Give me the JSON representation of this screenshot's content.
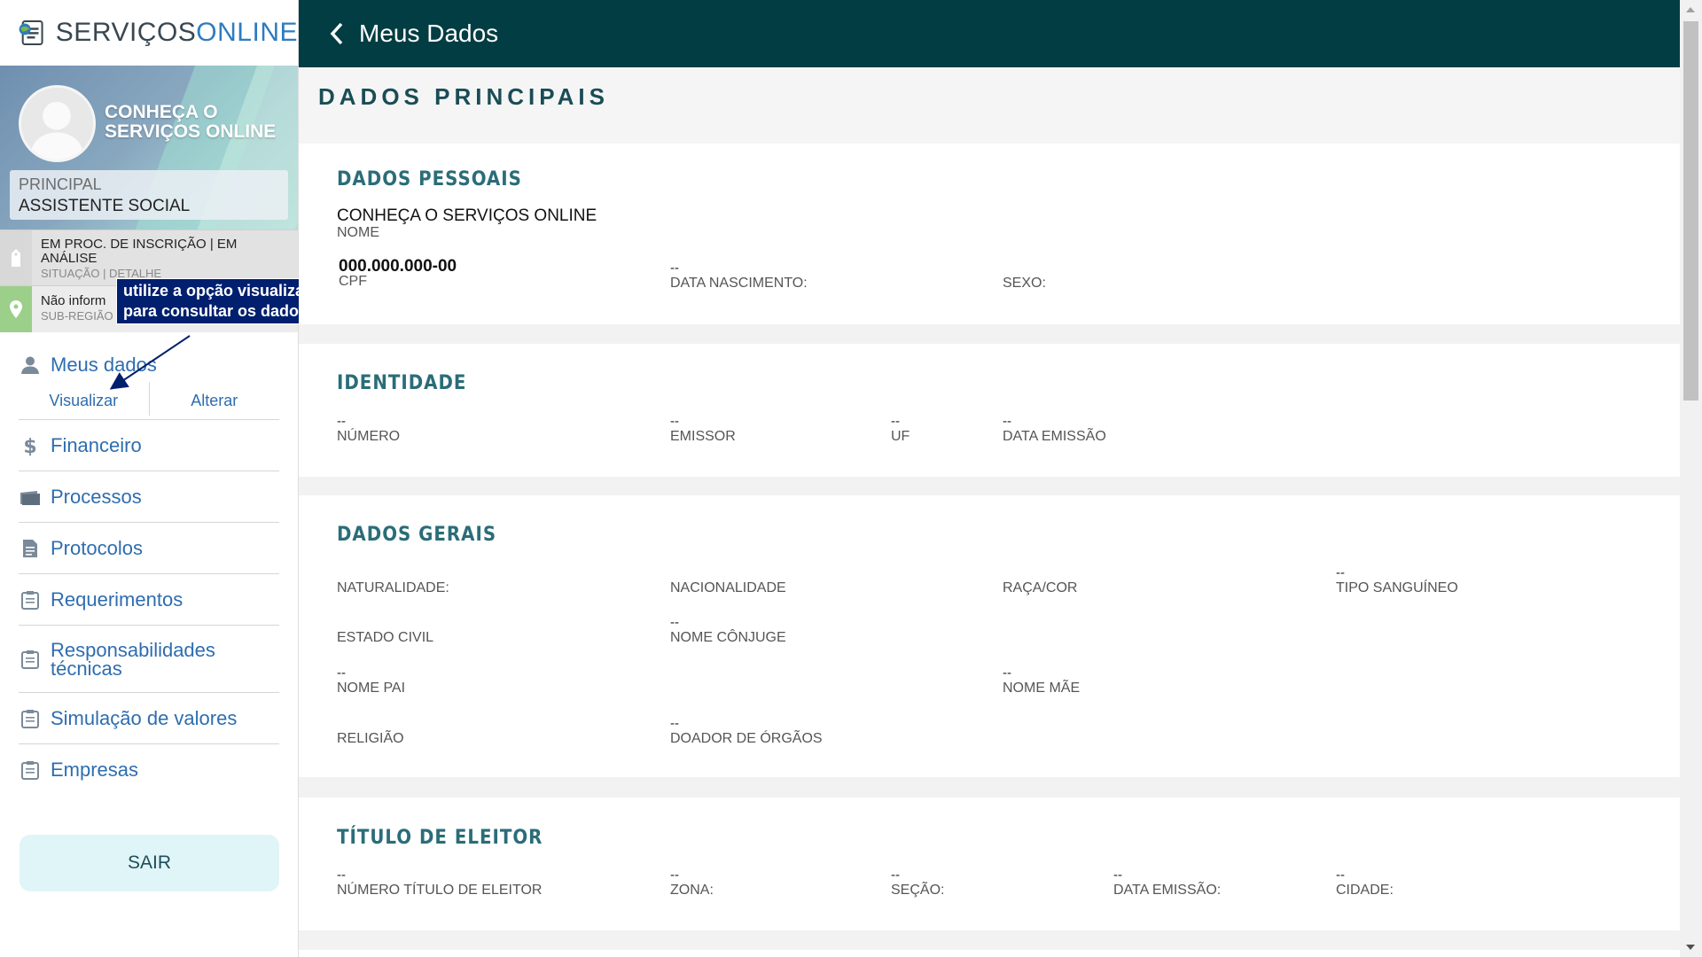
{
  "app": {
    "logo_a": "SERVIÇOS",
    "logo_b": "ONLINE"
  },
  "profile": {
    "name": "CONHEÇA O SERVIÇOS ONLINE",
    "role_label": "PRINCIPAL",
    "role_value": "ASSISTENTE SOCIAL"
  },
  "status": {
    "situacao_value": "EM PROC. DE INSCRIÇÃO | EM ANÁLISE",
    "situacao_label": "SITUAÇÃO | DETALHE",
    "subregiao_value": "Não inform",
    "subregiao_label": "SUB-REGIÃO"
  },
  "tooltip": {
    "line1": "utilize a opção visualizar",
    "line2": "para consultar os dados"
  },
  "menu": {
    "meus_dados": "Meus dados",
    "visualizar": "Visualizar",
    "alterar": "Alterar",
    "items": [
      {
        "label": "Financeiro",
        "icon": "dollar-icon"
      },
      {
        "label": "Processos",
        "icon": "folder-icon"
      },
      {
        "label": "Protocolos",
        "icon": "document-icon"
      },
      {
        "label": "Requerimentos",
        "icon": "clipboard-icon"
      },
      {
        "label": "Responsabilidades técnicas",
        "icon": "clipboard-icon"
      },
      {
        "label": "Simulação de valores",
        "icon": "clipboard-icon"
      },
      {
        "label": "Empresas",
        "icon": "clipboard-icon"
      }
    ],
    "logout": "SAIR"
  },
  "header": {
    "title": "Meus Dados"
  },
  "page": {
    "title": "DADOS PRINCIPAIS"
  },
  "pessoais": {
    "title": "DADOS PESSOAIS",
    "nome_value": "CONHEÇA O SERVIÇOS ONLINE",
    "nome_label": "NOME",
    "cpf_value": "000.000.000-00",
    "cpf_label": "CPF",
    "nasc_value": "--",
    "nasc_label": "DATA NASCIMENTO:",
    "sexo_value": "",
    "sexo_label": "SEXO:"
  },
  "identidade": {
    "title": "IDENTIDADE",
    "numero_value": "--",
    "numero_label": "NÚMERO",
    "emissor_value": "--",
    "emissor_label": "EMISSOR",
    "uf_value": "--",
    "uf_label": "UF",
    "data_value": "--",
    "data_label": "DATA EMISSÃO"
  },
  "gerais": {
    "title": "DADOS GERAIS",
    "naturalidade_label": "NATURALIDADE:",
    "nacionalidade_label": "NACIONALIDADE",
    "raca_label": "RAÇA/COR",
    "sangue_value": "--",
    "sangue_label": "TIPO SANGUÍNEO",
    "civil_label": "ESTADO CIVIL",
    "conjuge_value": "--",
    "conjuge_label": "NOME CÔNJUGE",
    "pai_value": "--",
    "pai_label": "NOME PAI",
    "mae_value": "--",
    "mae_label": "NOME MÃE",
    "religiao_label": "RELIGIÃO",
    "doador_value": "--",
    "doador_label": "DOADOR DE ÓRGÃOS"
  },
  "eleitor": {
    "title": "TÍTULO DE ELEITOR",
    "numero_value": "--",
    "numero_label": "NÚMERO TÍTULO DE ELEITOR",
    "zona_value": "--",
    "zona_label": "ZONA:",
    "secao_value": "--",
    "secao_label": "SEÇÃO:",
    "data_value": "--",
    "data_label": "DATA EMISSÃO:",
    "cidade_value": "--",
    "cidade_label": "CIDADE:"
  },
  "colors": {
    "header_bg": "#013d42",
    "accent_link": "#2e6db0",
    "section_title": "#2a6d78",
    "tooltip_bg": "#001f6e"
  }
}
